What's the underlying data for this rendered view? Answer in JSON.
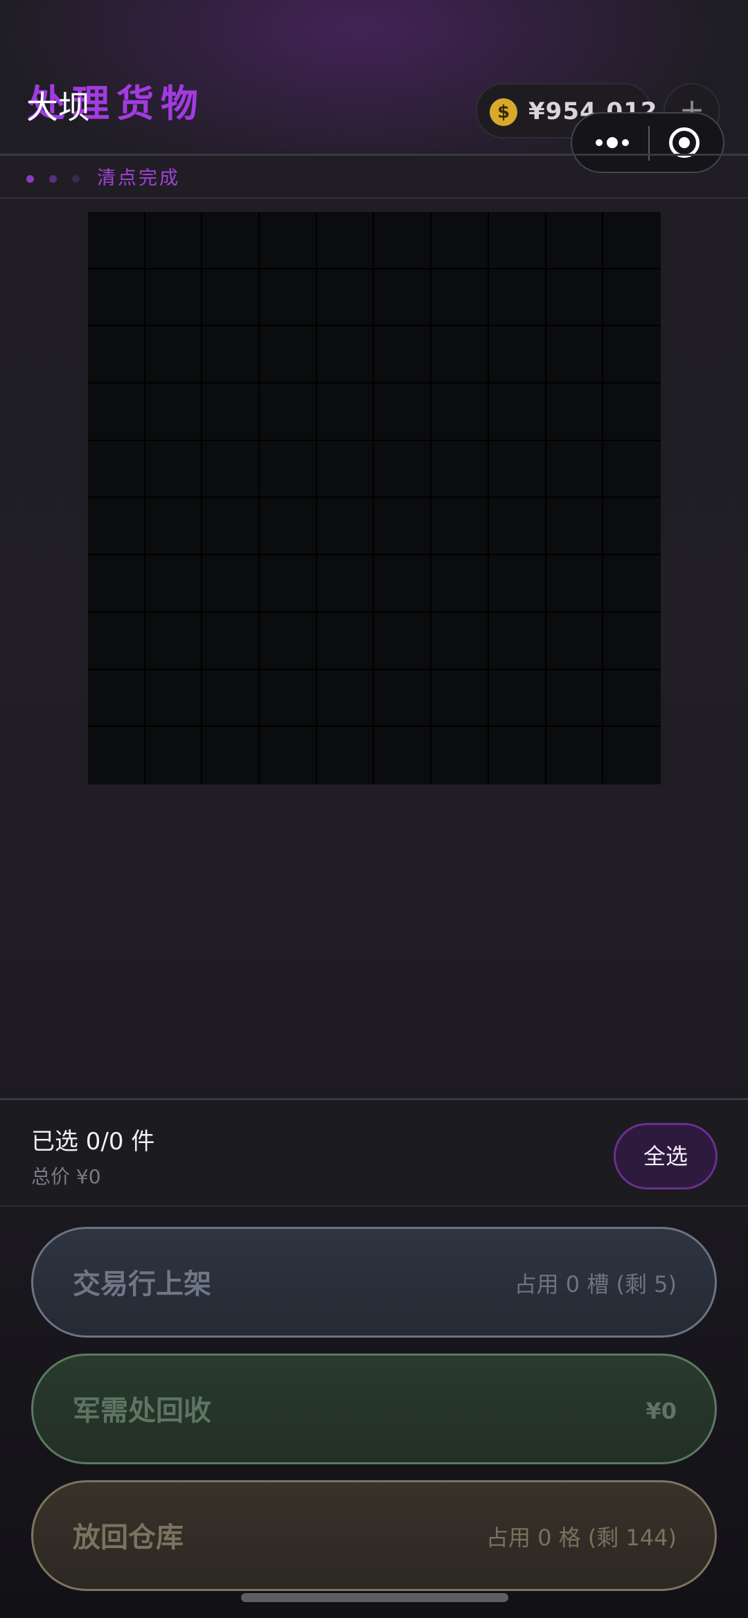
{
  "header": {
    "title": "处理货物",
    "mini_title": "大坝",
    "coins": "¥954,012",
    "coin_icon": "dollar-coin-icon",
    "add_icon": "plus-icon",
    "add_label": "+"
  },
  "steps": {
    "dots": [
      "#8a3dc0",
      "#5a2f7a",
      "#3a2a48"
    ],
    "label": "清点完成"
  },
  "colors": {
    "accent": "#a23be2",
    "grid_cell": "#0b0c0e",
    "trade": "#6a7486",
    "recycle": "#5c7a60",
    "store": "#7f7460"
  },
  "grid": {
    "rows": 10,
    "cols": 10
  },
  "summary": {
    "selected": "已选 0/0 件",
    "total": "总价 ¥0",
    "select_all": "全选"
  },
  "actions": {
    "trade": {
      "label": "交易行上架",
      "meta": "占用 0 槽 (剩 5)"
    },
    "recycle": {
      "label": "军需处回收",
      "meta": "¥0"
    },
    "store": {
      "label": "放回仓库",
      "meta": "占用 0 格 (剩 144)"
    }
  }
}
